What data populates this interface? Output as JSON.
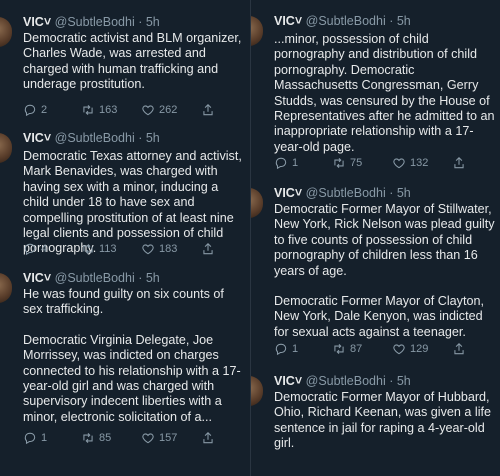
{
  "tweets": [
    {
      "author": "VIC˅",
      "handle": "@SubtleBodhi · 5h",
      "paragraphs": [
        "Democratic activist and BLM organizer, Charles Wade, was arrested and charged with human trafficking and underage prostitution."
      ],
      "replies": "2",
      "retweets": "163",
      "likes": "262"
    },
    {
      "author": "VIC˅",
      "handle": "@SubtleBodhi · 5h",
      "paragraphs": [
        "Democratic Texas attorney and activist, Mark Benavides, was charged with having sex with a minor, inducing a child under 18 to have sex and compelling prostitution of at least nine legal clients and possession of child pornography."
      ],
      "replies": "4",
      "retweets": "113",
      "likes": "183"
    },
    {
      "author": "VIC˅",
      "handle": "@SubtleBodhi · 5h",
      "paragraphs": [
        "He was found guilty on six counts of sex trafficking.",
        "Democratic Virginia Delegate, Joe Morrissey, was indicted on charges connected to his relationship with a 17-year-old girl and was charged with supervisory indecent liberties with a minor, electronic solicitation of a..."
      ],
      "replies": "1",
      "retweets": "85",
      "likes": "157"
    },
    {
      "author": "VIC˅",
      "handle": "@SubtleBodhi · 5h",
      "paragraphs": [
        "...minor, possession of child pornography and distribution of child pornography. Democratic Massachusetts Congressman, Gerry Studds, was censured by the House of Representatives after he admitted to an inappropriate relationship with a 17-year-old page."
      ],
      "replies": "1",
      "retweets": "75",
      "likes": "132"
    },
    {
      "author": "VIC˅",
      "handle": "@SubtleBodhi · 5h",
      "paragraphs": [
        "Democratic Former Mayor of Stillwater, New York, Rick Nelson was plead guilty to five counts of possession of child pornography of children less than 16 years of age.",
        "Democratic Former Mayor of Clayton, New York, Dale Kenyon, was indicted for sexual acts against a teenager."
      ],
      "replies": "1",
      "retweets": "87",
      "likes": "129"
    },
    {
      "author": "VIC˅",
      "handle": "@SubtleBodhi · 5h",
      "paragraphs": [
        "Democratic Former Mayor of Hubbard, Ohio, Richard Keenan, was given a life sentence in jail for raping a 4-year-old girl."
      ],
      "replies": "",
      "retweets": "",
      "likes": ""
    }
  ],
  "icons": {
    "reply": "reply-icon",
    "retweet": "retweet-icon",
    "like": "heart-icon",
    "share": "share-icon"
  },
  "colors": {
    "background": "#15202b",
    "text": "#e7e9ea",
    "muted": "#8899a6"
  }
}
